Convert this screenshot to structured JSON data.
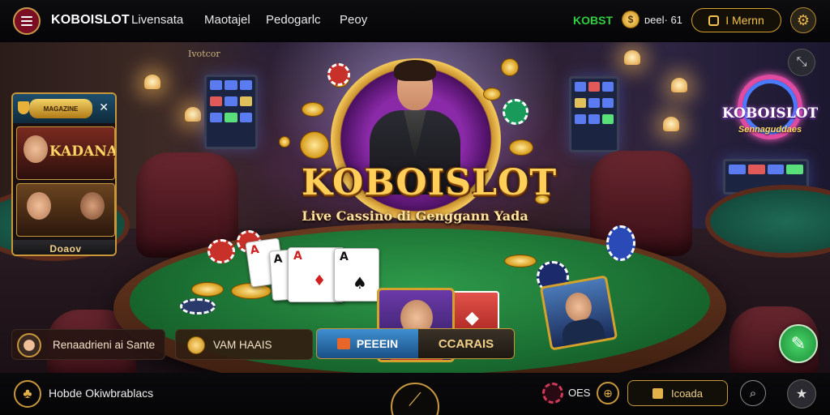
{
  "header": {
    "brand": "KOBOISLOT",
    "nav": [
      "Livensata",
      "Maotajel",
      "Pedogarlc",
      "Peoy"
    ],
    "promo": "KOBST",
    "balance": "ᴅeel· 61",
    "login_label": "I Mernn"
  },
  "hero": {
    "title": "KOBOISLOT",
    "subtitle": "Live Cassino di Genggann Yada"
  },
  "left_panel": {
    "badge": "MAGAZINE",
    "tile_title": "KADANAI",
    "footer": "Doaov"
  },
  "right_sign": {
    "title": "KOBOISLOT",
    "subtitle": "Sennaguddaes"
  },
  "wall_sign": "Ivotcor",
  "actions": {
    "player_label": "Renaadrieni ai Sante",
    "bonus_label": "VAM HAAIS",
    "primary_label": "PEEEIN",
    "secondary_label": "CCARAIS"
  },
  "footer": {
    "label": "Hobde Okiwbrablacs",
    "des": "OES",
    "wallet_label": "Icoada"
  },
  "icons": {
    "menu": "hamburger-icon",
    "coin": "coin-icon",
    "lock": "lock-icon",
    "settings": "gear-icon",
    "close": "close-icon",
    "edit": "pencil-icon",
    "club": "club-icon",
    "chip": "poker-chip-icon",
    "target": "target-icon",
    "search": "search-icon",
    "vip": "star-icon"
  },
  "colors": {
    "accent_gold": "#d4a12c",
    "promo_green": "#2fcf3d",
    "menu_red": "#7a0f23",
    "primary_blue": "#1a4f86",
    "edit_green": "#1b8a36"
  }
}
